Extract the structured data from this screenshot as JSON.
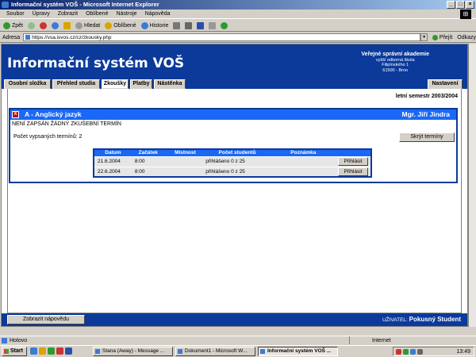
{
  "window": {
    "title": "Informační systém VOŠ - Microsoft Internet Explorer"
  },
  "menu": [
    "Soubor",
    "Úpravy",
    "Zobrazit",
    "Oblíbené",
    "Nástroje",
    "Nápověda"
  ],
  "toolbar": {
    "back": "Zpět",
    "search": "Hledat",
    "favorites": "Oblíbené",
    "history": "Historie"
  },
  "address": {
    "label": "Adresa",
    "url": "https://vsa.isvos.cz/cz/zkousky.php",
    "go": "Přejít",
    "links": "Odkazy"
  },
  "header": {
    "title": "Informační systém VOŠ",
    "org": "Veřejné správní akademie",
    "org_sub": "vyšší odborná škola",
    "street": "Filipínského 1",
    "city": "61500 - Brno"
  },
  "tabs": [
    "Osobní složka",
    "Přehled studia",
    "Zkoušky",
    "Platby",
    "Nástěnka"
  ],
  "tab_right": "Nastavení",
  "semester": "letní semestr 2003/2004",
  "course": {
    "name": "A - Anglický jazyk",
    "teacher": "Mgr. Jiří Jindra",
    "no_term": "NENÍ ZAPSÁN ŽÁDNÝ ZKUŠEBNÍ TERMÍN",
    "count": "Počet vypsaných termínů: 2",
    "hide_button": "Skrýt termíny"
  },
  "terms_table": {
    "headers": [
      "Datum",
      "Začátek",
      "Místnost",
      "Počet studentů",
      "Poznámka"
    ],
    "rows": [
      {
        "date": "21.6.2004",
        "start": "8:00",
        "room": "",
        "students": "přihlášeno 0 z 25",
        "note": "",
        "action": "Přihlásit"
      },
      {
        "date": "22.6.2004",
        "start": "8:00",
        "room": "",
        "students": "přihlášeno 0 z 25",
        "note": "",
        "action": "Přihlásit"
      }
    ]
  },
  "footer": {
    "help_button": "Zobrazit nápovědu",
    "user_label": "UŽIVATEL:",
    "user_name": "Pokusný Student"
  },
  "status": {
    "left": "Hotovo",
    "zone": "Internet"
  },
  "taskbar": {
    "start": "Start",
    "tasks": [
      "Stana (Away) - Message ...",
      "Dokument1 - Microsoft W...",
      "Informační systém VOŠ ..."
    ],
    "clock": "13:49"
  },
  "colors": {
    "brand_blue": "#0b3a9b",
    "accent_blue": "#1a68f5",
    "close_red": "#c40000"
  }
}
